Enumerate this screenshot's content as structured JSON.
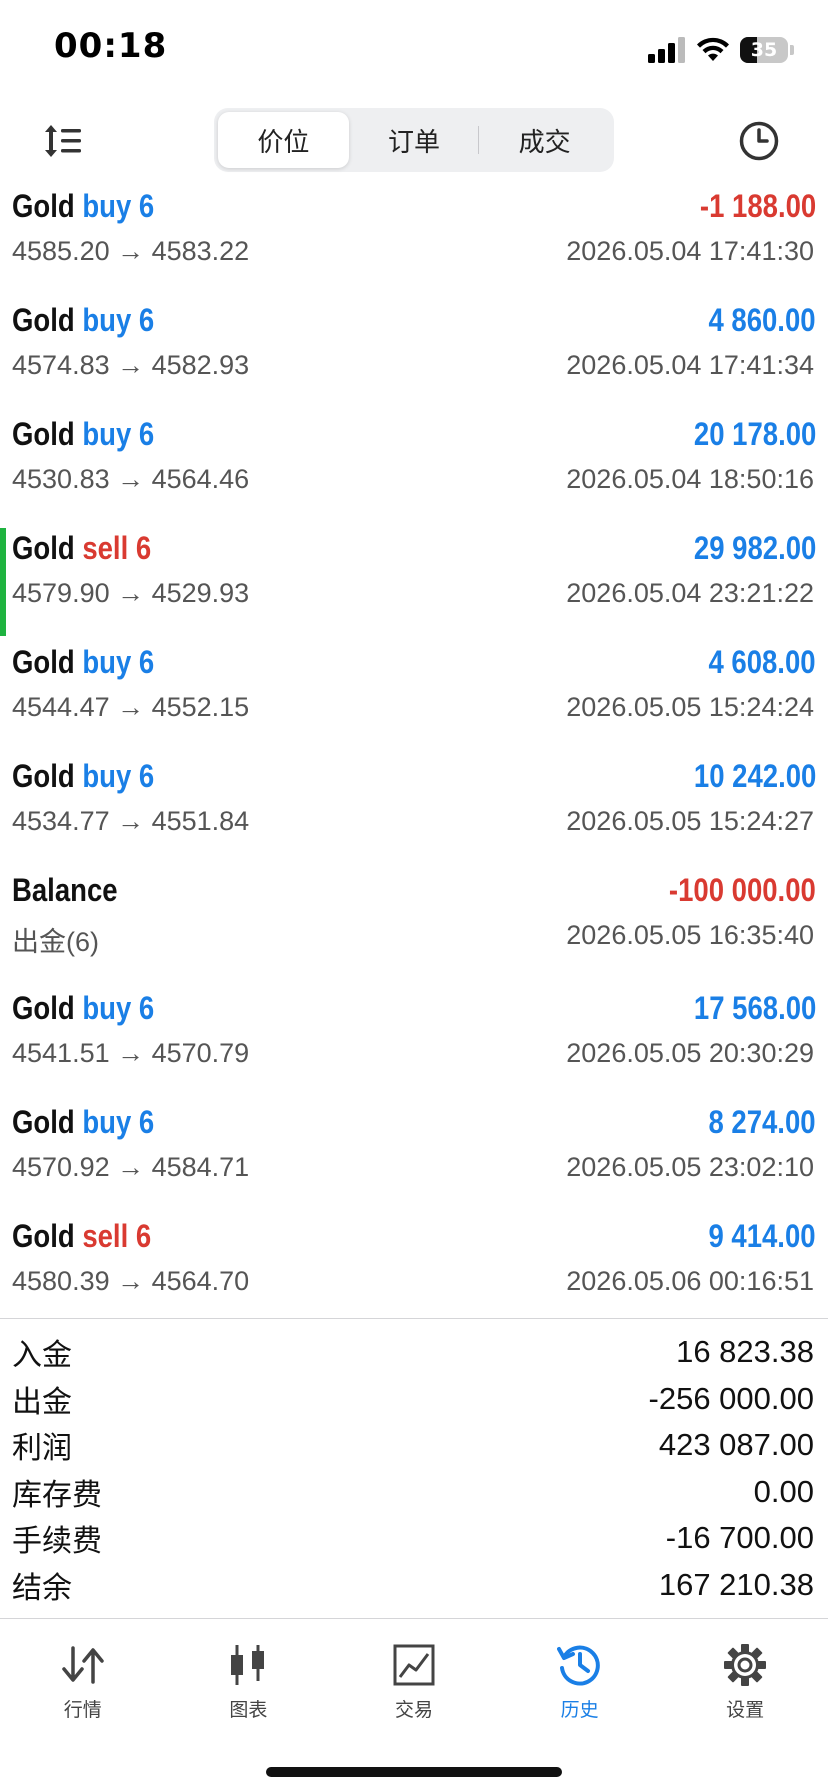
{
  "status_bar": {
    "time": "00:18",
    "battery_level": "35"
  },
  "toolbar": {
    "segments": [
      {
        "label": "价位",
        "active": true
      },
      {
        "label": "订单",
        "active": false
      },
      {
        "label": "成交",
        "active": false
      }
    ]
  },
  "deals": [
    {
      "symbol": "Gold",
      "side": "buy 6",
      "side_type": "buy",
      "prices": "4585.20 → 4583.22",
      "time": "2026.05.04 17:41:30",
      "profit": "-1 188.00",
      "negative": true
    },
    {
      "symbol": "Gold",
      "side": "buy 6",
      "side_type": "buy",
      "prices": "4574.83 → 4582.93",
      "time": "2026.05.04 17:41:34",
      "profit": "4 860.00",
      "negative": false
    },
    {
      "symbol": "Gold",
      "side": "buy 6",
      "side_type": "buy",
      "prices": "4530.83 → 4564.46",
      "time": "2026.05.04 18:50:16",
      "profit": "20 178.00",
      "negative": false
    },
    {
      "symbol": "Gold",
      "side": "sell 6",
      "side_type": "sell",
      "prices": "4579.90 → 4529.93",
      "time": "2026.05.04 23:21:22",
      "profit": "29 982.00",
      "negative": false,
      "selected": true
    },
    {
      "symbol": "Gold",
      "side": "buy 6",
      "side_type": "buy",
      "prices": "4544.47 → 4552.15",
      "time": "2026.05.05 15:24:24",
      "profit": "4 608.00",
      "negative": false
    },
    {
      "symbol": "Gold",
      "side": "buy 6",
      "side_type": "buy",
      "prices": "4534.77 → 4551.84",
      "time": "2026.05.05 15:24:27",
      "profit": "10 242.00",
      "negative": false
    },
    {
      "symbol": "Balance",
      "side": "",
      "side_type": "balance",
      "prices": "出金(6)",
      "time": "2026.05.05 16:35:40",
      "profit": "-100 000.00",
      "negative": true
    },
    {
      "symbol": "Gold",
      "side": "buy 6",
      "side_type": "buy",
      "prices": "4541.51 → 4570.79",
      "time": "2026.05.05 20:30:29",
      "profit": "17 568.00",
      "negative": false
    },
    {
      "symbol": "Gold",
      "side": "buy 6",
      "side_type": "buy",
      "prices": "4570.92 → 4584.71",
      "time": "2026.05.05 23:02:10",
      "profit": "8 274.00",
      "negative": false
    },
    {
      "symbol": "Gold",
      "side": "sell 6",
      "side_type": "sell",
      "prices": "4580.39 → 4564.70",
      "time": "2026.05.06 00:16:51",
      "profit": "9 414.00",
      "negative": false
    }
  ],
  "summary": [
    {
      "label": "入金",
      "value": "16 823.38"
    },
    {
      "label": "出金",
      "value": "-256 000.00"
    },
    {
      "label": "利润",
      "value": "423 087.00"
    },
    {
      "label": "库存费",
      "value": "0.00"
    },
    {
      "label": "手续费",
      "value": "-16 700.00"
    },
    {
      "label": "结余",
      "value": "167 210.38"
    }
  ],
  "tabbar": {
    "items": [
      {
        "label": "行情",
        "icon": "quotes-icon",
        "active": false
      },
      {
        "label": "图表",
        "icon": "chart-icon",
        "active": false
      },
      {
        "label": "交易",
        "icon": "trade-icon",
        "active": false
      },
      {
        "label": "历史",
        "icon": "history-icon",
        "active": true
      },
      {
        "label": "设置",
        "icon": "settings-icon",
        "active": false
      }
    ]
  },
  "colors": {
    "accent_blue": "#1a7fe6",
    "loss_red": "#d93a31",
    "selected_green": "#1fb340"
  }
}
